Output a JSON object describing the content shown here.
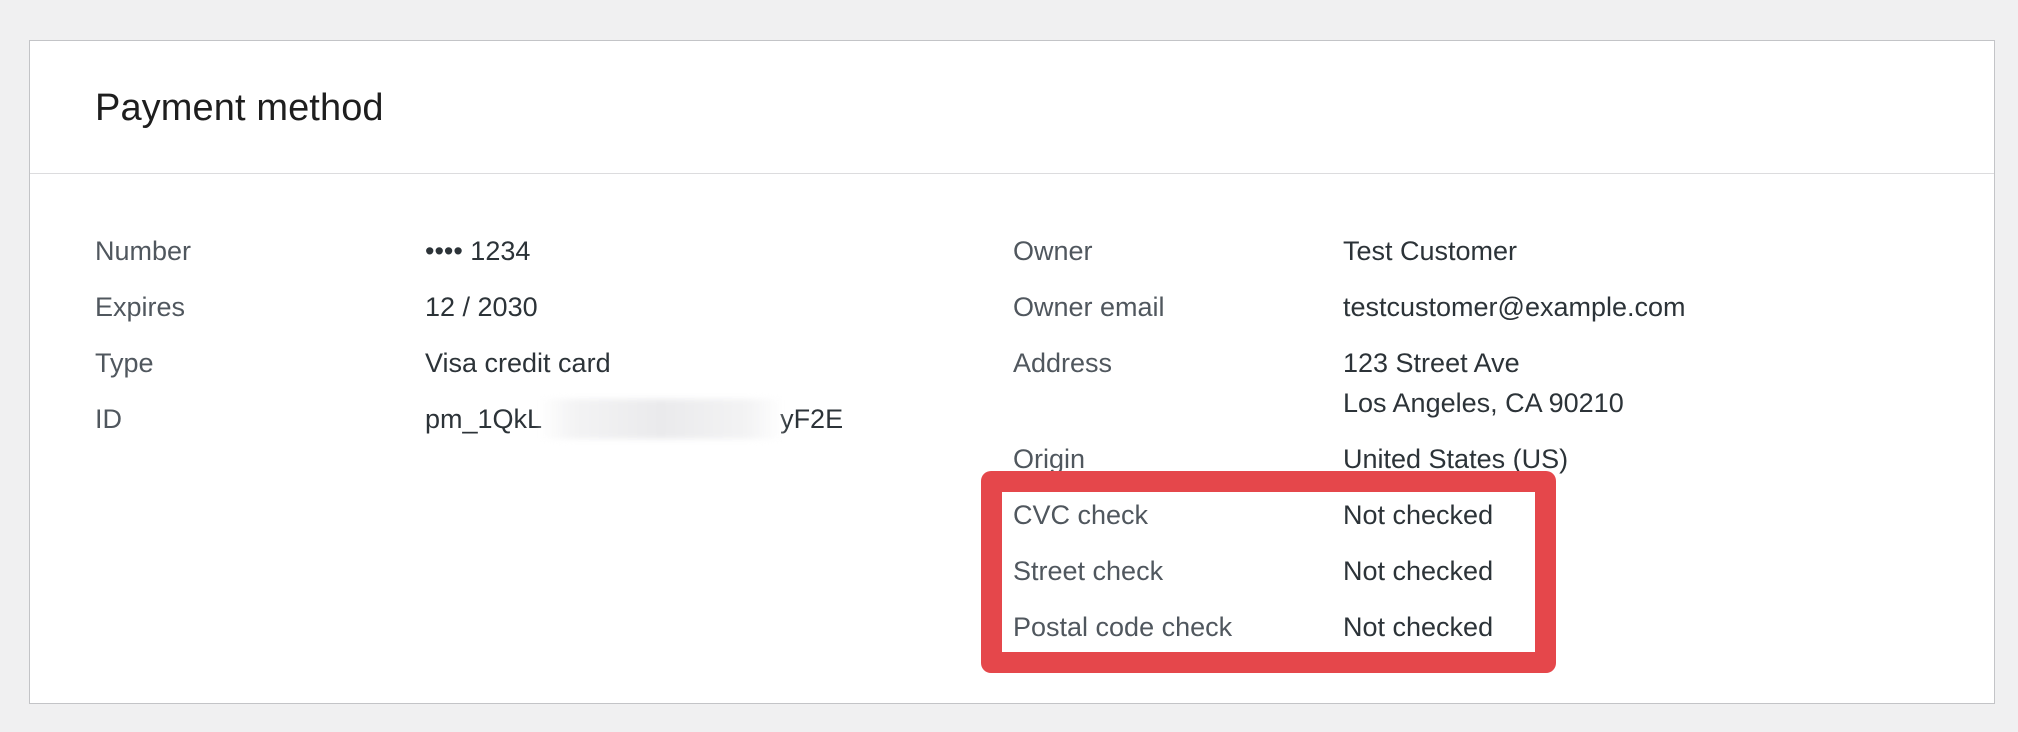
{
  "card": {
    "title": "Payment method"
  },
  "left_details": [
    {
      "label": "Number",
      "value": "•••• 1234"
    },
    {
      "label": "Expires",
      "value": "12 / 2030"
    },
    {
      "label": "Type",
      "value": "Visa credit card"
    },
    {
      "label": "ID",
      "value_prefix": "pm_1QkL",
      "value_suffix": "yF2E"
    }
  ],
  "right_details": [
    {
      "label": "Owner",
      "value": "Test Customer"
    },
    {
      "label": "Owner email",
      "value": "testcustomer@example.com"
    },
    {
      "label": "Address",
      "value_line1": "123 Street Ave",
      "value_line2": "Los Angeles, CA 90210"
    },
    {
      "label": "Origin",
      "value": "United States (US)"
    },
    {
      "label": "CVC check",
      "value": "Not checked"
    },
    {
      "label": "Street check",
      "value": "Not checked"
    },
    {
      "label": "Postal code check",
      "value": "Not checked"
    }
  ],
  "colors": {
    "highlight": "#e5474b",
    "label": "#50575e",
    "value": "#2c3338"
  }
}
